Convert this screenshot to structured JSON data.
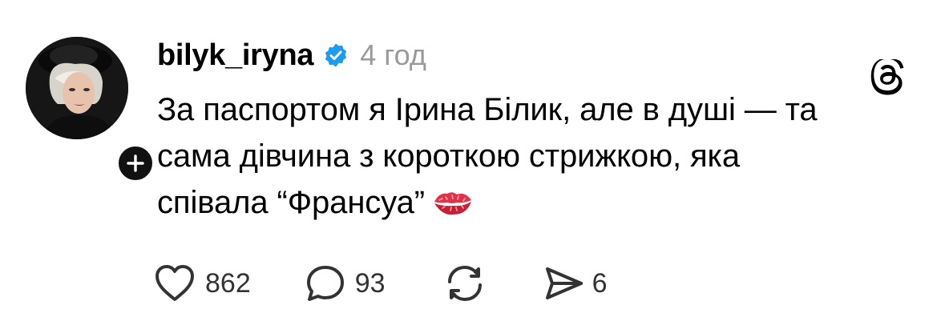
{
  "post": {
    "username": "bilyk_iryna",
    "verified": true,
    "time": "4 год",
    "text_lines": [
      "За паспортом я Ірина Білик, але в душі — та",
      "сама дівчина з короткою стрижкою, яка",
      "співала “Франсуа”"
    ],
    "emoji": "kiss-mark"
  },
  "actions": {
    "likes": "862",
    "replies": "93",
    "shares": "6"
  },
  "colors": {
    "verified": "#1D9BF0",
    "muted": "#9A9A9A",
    "icon": "#333333"
  }
}
